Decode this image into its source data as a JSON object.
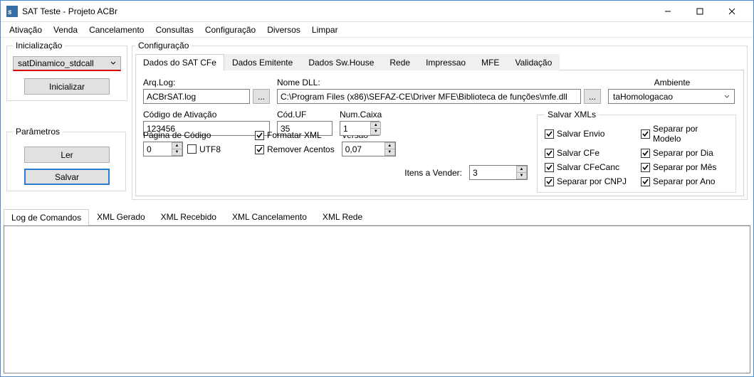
{
  "window": {
    "title": "SAT Teste - Projeto ACBr"
  },
  "menu": [
    "Ativação",
    "Venda",
    "Cancelamento",
    "Consultas",
    "Configuração",
    "Diversos",
    "Limpar"
  ],
  "left": {
    "inic_legend": "Inicialização",
    "dll_type": "satDinamico_stdcall",
    "inicializar": "Inicializar",
    "param_legend": "Parâmetros",
    "ler": "Ler",
    "salvar": "Salvar"
  },
  "config": {
    "legend": "Configuração",
    "tabs": [
      "Dados do SAT CFe",
      "Dados Emitente",
      "Dados Sw.House",
      "Rede",
      "Impressao",
      "MFE",
      "Validação"
    ],
    "arqlog_lbl": "Arq.Log:",
    "arqlog": "ACBrSAT.log",
    "nome_dll_lbl": "Nome DLL:",
    "nome_dll": "C:\\Program Files (x86)\\SEFAZ-CE\\Driver MFE\\Biblioteca de funções\\mfe.dll",
    "ambiente_lbl": "Ambiente",
    "ambiente": "taHomologacao",
    "cod_ativ_lbl": "Código de Ativação",
    "cod_ativ": "123456",
    "cod_uf_lbl": "Cód.UF",
    "cod_uf": "35",
    "num_caixa_lbl": "Num.Caixa",
    "num_caixa": "1",
    "pag_cod_lbl": "Página de Código",
    "pag_cod": "0",
    "utf8": "UTF8",
    "formatar_xml": "Formatar XML",
    "remover_acentos": "Remover Acentos",
    "versao_lbl": "Versão",
    "versao": "0,07",
    "itens_lbl": "Itens a Vender:",
    "itens": "3",
    "salvar_xml_legend": "Salvar XMLs",
    "chks": {
      "salvar_envio": "Salvar Envio",
      "sep_modelo": "Separar por Modelo",
      "salvar_cfe": "Salvar CFe",
      "sep_dia": "Separar por Dia",
      "salvar_cfecanc": "Salvar CFeCanc",
      "sep_mes": "Separar por Mês",
      "sep_cnpj": "Separar por CNPJ",
      "sep_ano": "Separar por Ano"
    }
  },
  "log": {
    "tabs": [
      "Log de Comandos",
      "XML Gerado",
      "XML Recebido",
      "XML Cancelamento",
      "XML Rede"
    ]
  }
}
